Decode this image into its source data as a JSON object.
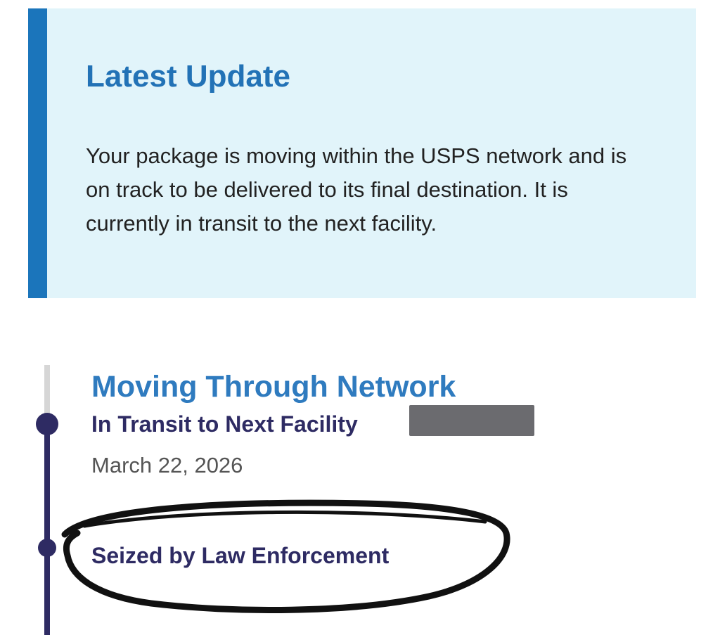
{
  "latest_update": {
    "title": "Latest Update",
    "body": "Your package is moving within the USPS network and is on track to be delivered to its final destination. It is currently in transit to the next facility."
  },
  "timeline": {
    "events": [
      {
        "title": "Moving Through Network",
        "status": "In Transit to Next Facility",
        "date": "March 22, 2026"
      },
      {
        "status": "Seized by Law Enforcement"
      }
    ]
  },
  "colors": {
    "card_background": "#e1f4fa",
    "accent_blue": "#1b75bb",
    "title_blue": "#2f7bbf",
    "navy": "#2e2b63",
    "redaction_gray": "#6b6b6f",
    "marker_black": "#111111"
  }
}
